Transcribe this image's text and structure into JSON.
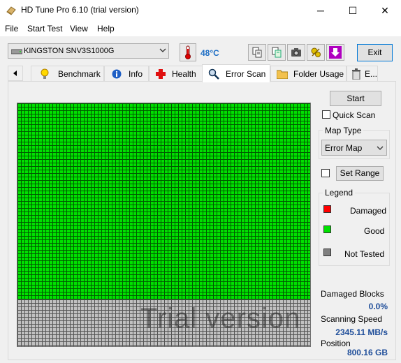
{
  "window": {
    "title": "HD Tune Pro 6.10 (trial version)",
    "minimize": "─",
    "maximize": "☐",
    "close": "✕"
  },
  "menu": [
    "File",
    "Start Test",
    "View",
    "Help"
  ],
  "toolbar": {
    "drive": "KINGSTON SNV3S1000G",
    "temperature": "48°C",
    "exit_label": "Exit"
  },
  "tabs": [
    {
      "label": "Benchmark",
      "icon": "lightbulb-icon"
    },
    {
      "label": "Info",
      "icon": "info-icon"
    },
    {
      "label": "Health",
      "icon": "health-cross-icon"
    },
    {
      "label": "Error Scan",
      "icon": "magnifier-icon",
      "active": true
    },
    {
      "label": "Folder Usage",
      "icon": "folder-icon"
    },
    {
      "label": "E...",
      "icon": "trash-icon"
    }
  ],
  "scan": {
    "start_label": "Start",
    "quick_scan_label": "Quick Scan",
    "map_type_label": "Map Type",
    "map_type_value": "Error Map",
    "set_range_label": "Set Range",
    "legend_label": "Legend",
    "legend": [
      {
        "label": "Damaged",
        "color": "#ff0000"
      },
      {
        "label": "Good",
        "color": "#00e000"
      },
      {
        "label": "Not Tested",
        "color": "#808080"
      }
    ],
    "watermark": "Trial version",
    "good_fraction": 0.8
  },
  "stats": {
    "damaged_label": "Damaged Blocks",
    "damaged_value": "0.0%",
    "speed_label": "Scanning Speed",
    "speed_value": "2345.11 MB/s",
    "position_label": "Position",
    "position_value": "800.16 GB"
  }
}
